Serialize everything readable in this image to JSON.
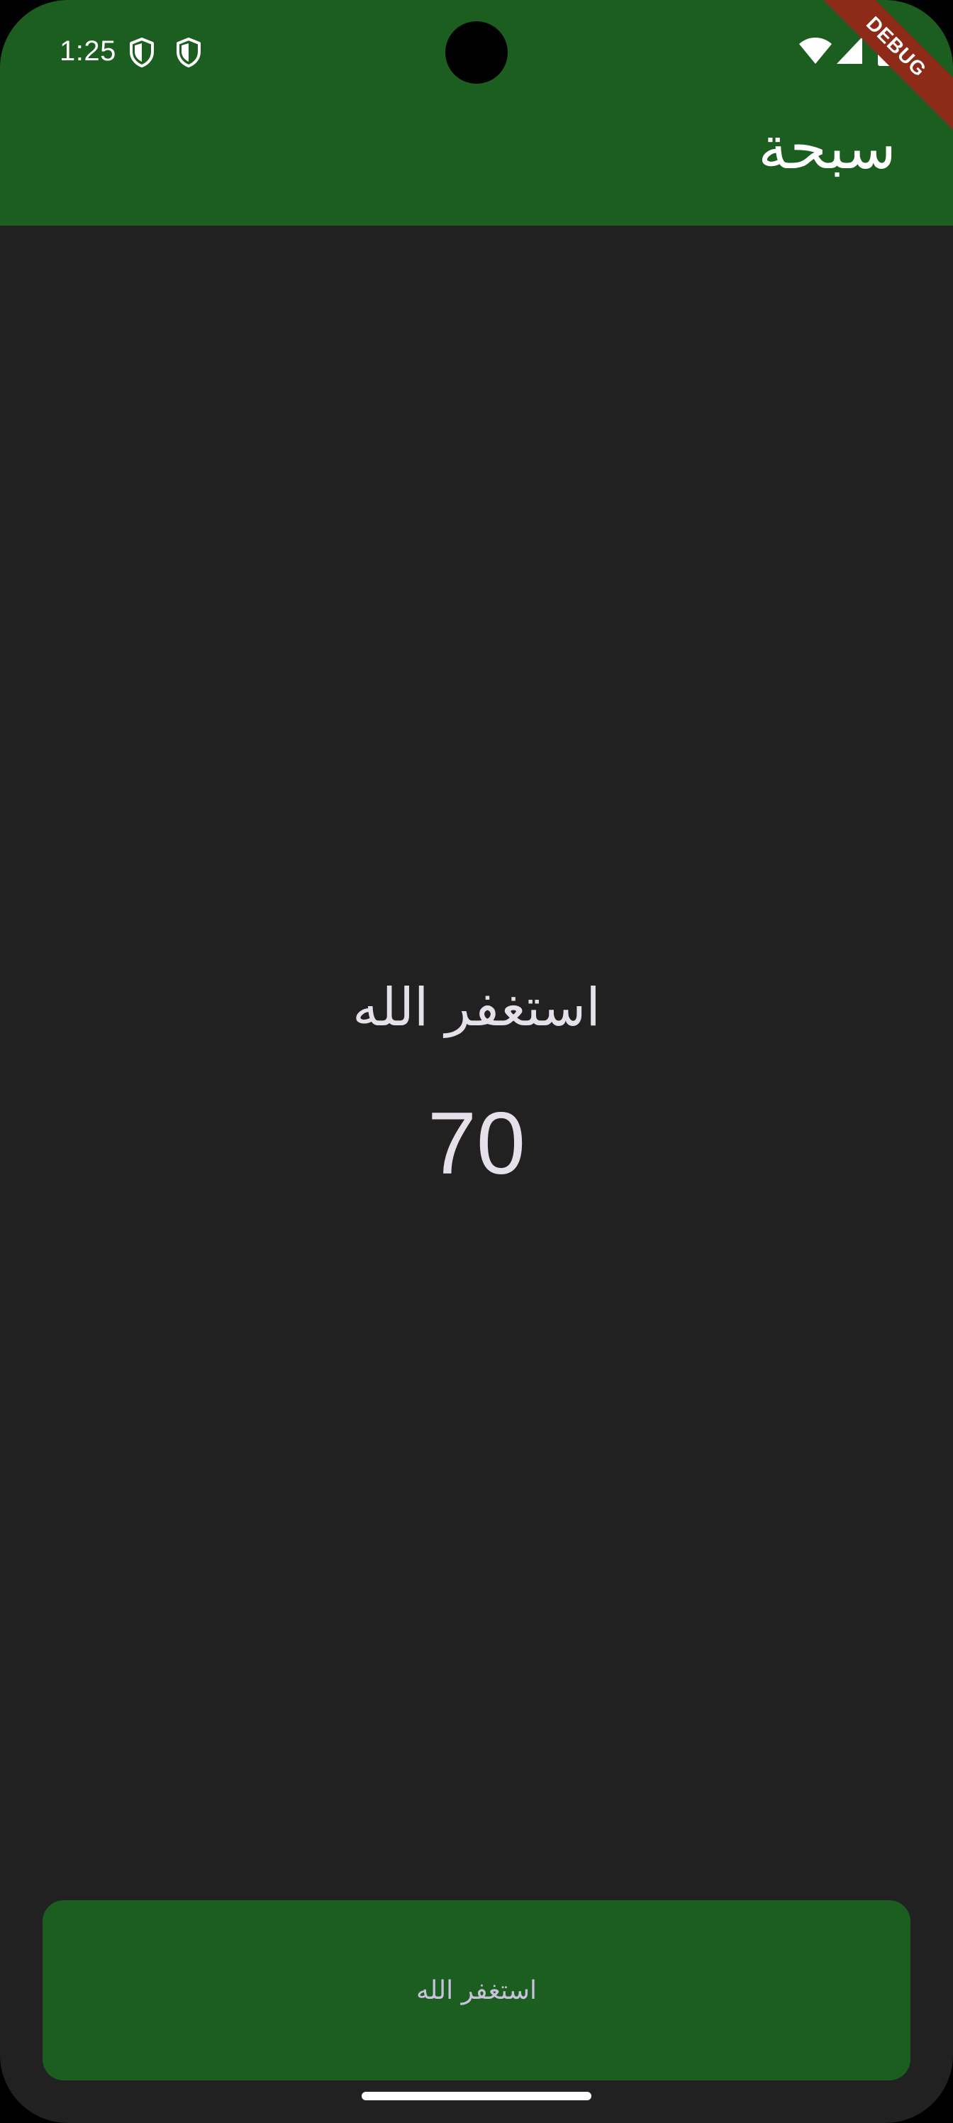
{
  "status_bar": {
    "time": "1:25",
    "icons": [
      "shield-icon",
      "shield-icon",
      "wifi-icon",
      "signal-icon",
      "battery-icon"
    ]
  },
  "debug_banner": {
    "label": "DEBUG"
  },
  "app_bar": {
    "title": "سبحة"
  },
  "counter_view": {
    "dhikr_text": "استغفر الله",
    "count": "70"
  },
  "action_button": {
    "label": "استغفر الله"
  },
  "colors": {
    "primary_green": "#1c5e20",
    "background": "#212121",
    "text_light": "#e6e0ea",
    "button_text": "#c8c2dc",
    "debug_ribbon": "#8e2a18"
  }
}
